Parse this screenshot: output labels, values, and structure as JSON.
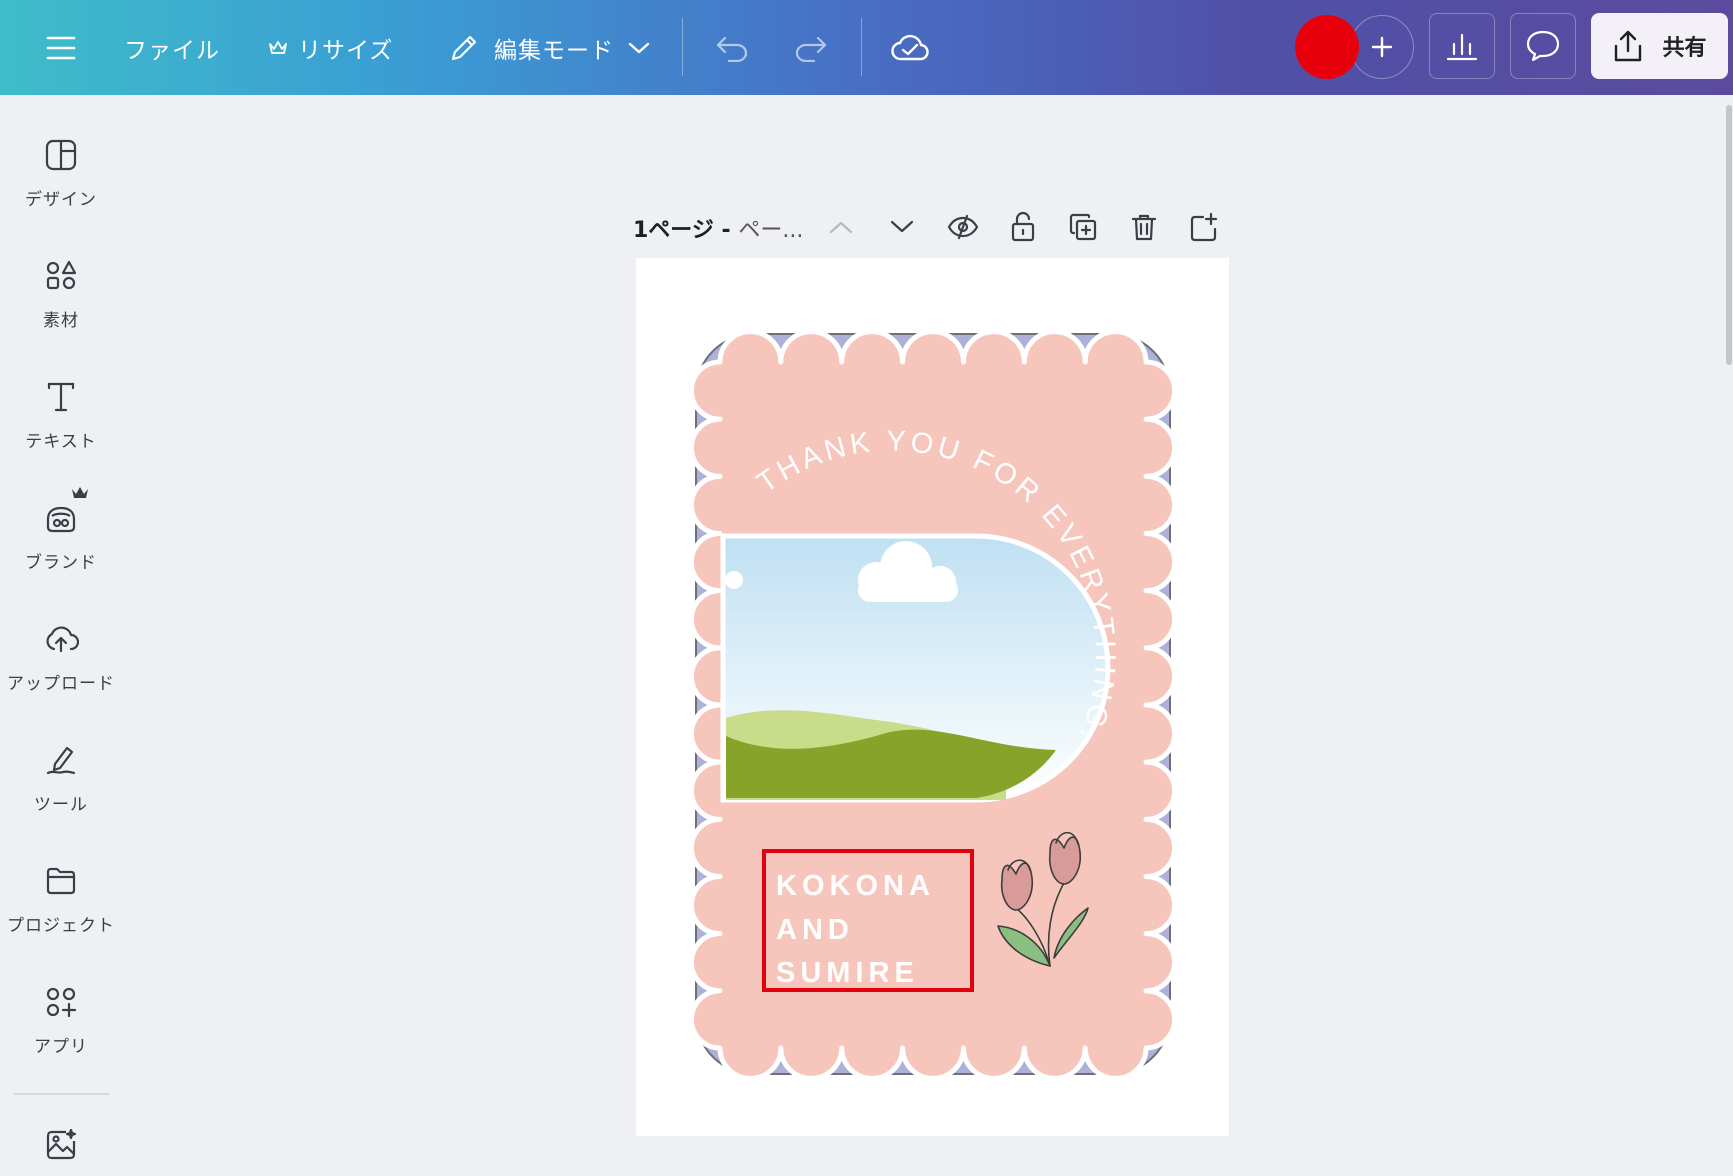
{
  "topbar": {
    "menu_icon": "hamburger-menu-icon",
    "file_label": "ファイル",
    "resize_label": "リサイズ",
    "mode_label": "編集モード",
    "share_label": "共有",
    "avatar_color": "#e8000d"
  },
  "sidebar": {
    "items": [
      {
        "label": "デザイン",
        "icon": "design-icon"
      },
      {
        "label": "素材",
        "icon": "elements-icon"
      },
      {
        "label": "テキスト",
        "icon": "text-icon"
      },
      {
        "label": "ブランド",
        "icon": "brand-icon"
      },
      {
        "label": "アップロード",
        "icon": "upload-icon"
      },
      {
        "label": "ツール",
        "icon": "tools-icon"
      },
      {
        "label": "プロジェクト",
        "icon": "folder-icon"
      },
      {
        "label": "アプリ",
        "icon": "apps-icon"
      }
    ]
  },
  "page_toolbar": {
    "title": "1ページ - ",
    "title_rest": "ペー..."
  },
  "design": {
    "arc_text": "THANK YOU FOR EVERYTHING.",
    "name_lines": [
      "KOKONA",
      "AND",
      "SUMIRE"
    ],
    "colors": {
      "frame": "#adb0d8",
      "paper": "#f6c6bd",
      "highlight": "#e2000d",
      "hill_dark": "#88a32a",
      "hill_light": "#c8dc8a"
    }
  }
}
